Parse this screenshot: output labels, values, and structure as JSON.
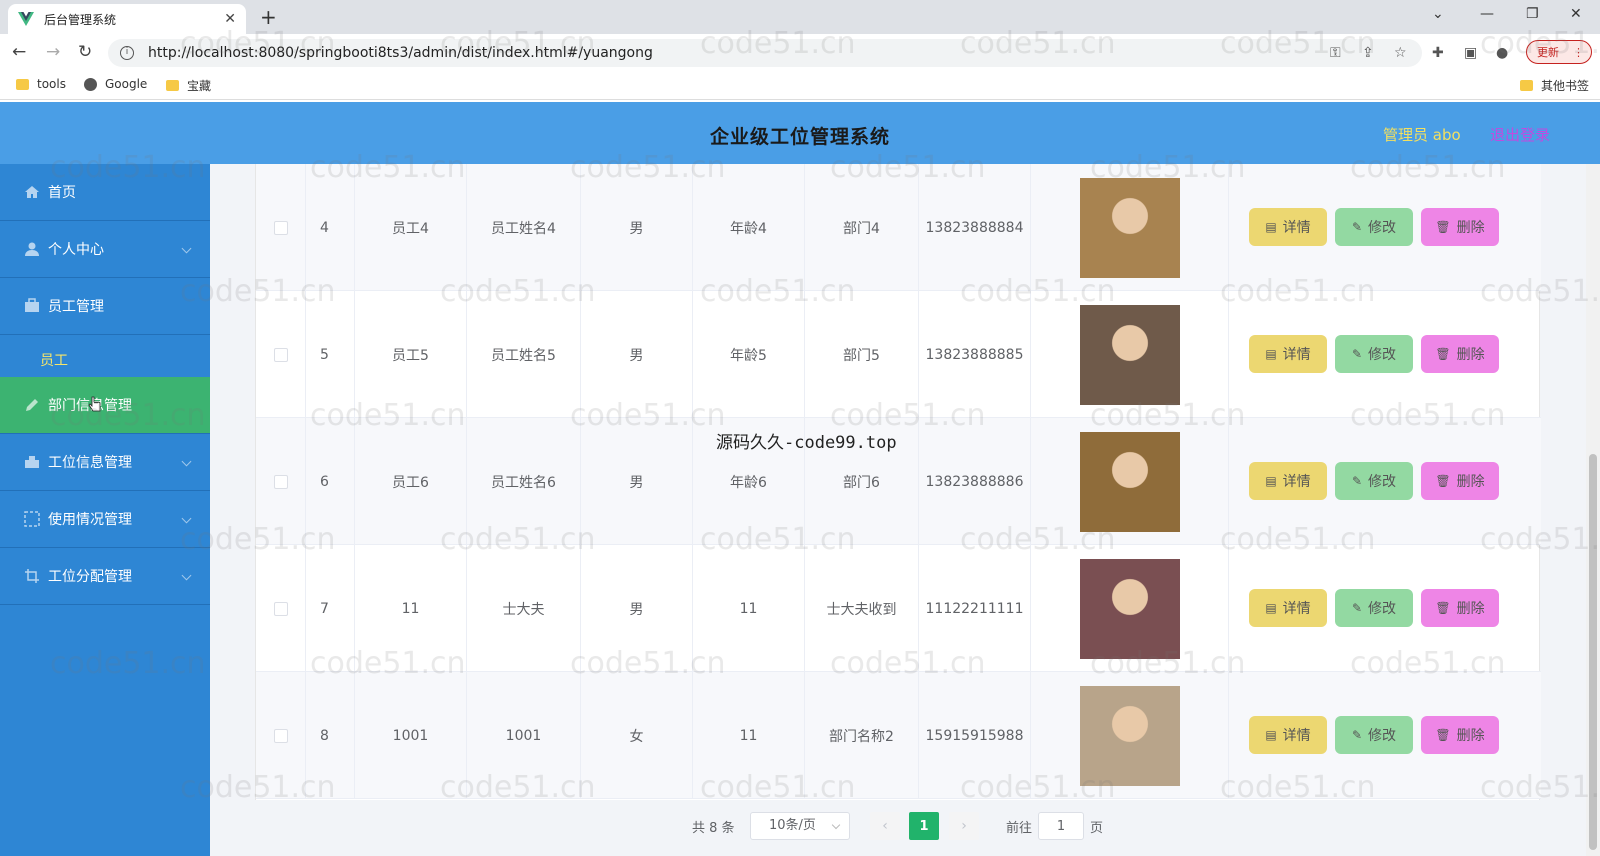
{
  "browser": {
    "tab_title": "后台管理系统",
    "url": "http://localhost:8080/springbooti8ts3/admin/dist/index.html#/yuangong",
    "update_label": "更新",
    "bookmarks": [
      "tools",
      "Google",
      "宝藏"
    ],
    "other_bookmarks": "其他书签"
  },
  "header": {
    "title": "企业级工位管理系统",
    "admin_label": "管理员 abo",
    "logout_label": "退出登录"
  },
  "sidebar": {
    "items": [
      {
        "label": "首页",
        "icon": "home-icon"
      },
      {
        "label": "个人中心",
        "icon": "user-icon"
      },
      {
        "label": "员工管理",
        "icon": "briefcase-icon"
      },
      {
        "label": "员工",
        "icon": ""
      },
      {
        "label": "部门信息管理",
        "icon": "edit-icon"
      },
      {
        "label": "工位信息管理",
        "icon": "desk-icon"
      },
      {
        "label": "使用情况管理",
        "icon": "grid-icon"
      },
      {
        "label": "工位分配管理",
        "icon": "crop-icon"
      }
    ]
  },
  "table": {
    "rows": [
      {
        "index": "4",
        "emp_no": "员工4",
        "name": "员工姓名4",
        "gender": "男",
        "age": "年龄4",
        "dept": "部门4",
        "phone": "13823888884",
        "photo_color": "#a88350"
      },
      {
        "index": "5",
        "emp_no": "员工5",
        "name": "员工姓名5",
        "gender": "男",
        "age": "年龄5",
        "dept": "部门5",
        "phone": "13823888885",
        "photo_color": "#6f5a4a"
      },
      {
        "index": "6",
        "emp_no": "员工6",
        "name": "员工姓名6",
        "gender": "男",
        "age": "年龄6",
        "dept": "部门6",
        "phone": "13823888886",
        "photo_color": "#8f6c3a"
      },
      {
        "index": "7",
        "emp_no": "11",
        "name": "士大夫",
        "gender": "男",
        "age": "11",
        "dept": "士大夫收到",
        "phone": "11122211111",
        "photo_color": "#7a4f52"
      },
      {
        "index": "8",
        "emp_no": "1001",
        "name": "1001",
        "gender": "女",
        "age": "11",
        "dept": "部门名称2",
        "phone": "15915915988",
        "photo_color": "#b8a48a"
      }
    ],
    "actions": {
      "detail": "详情",
      "edit": "修改",
      "delete": "删除"
    }
  },
  "pagination": {
    "total_text": "共 8 条",
    "page_size": "10条/页",
    "current_page": "1",
    "goto_label": "前往",
    "goto_value": "1",
    "page_suffix": "页",
    "prev": "‹",
    "next": "›"
  },
  "overlay_text": "源码久久-code99.top",
  "watermark": "code51.cn"
}
